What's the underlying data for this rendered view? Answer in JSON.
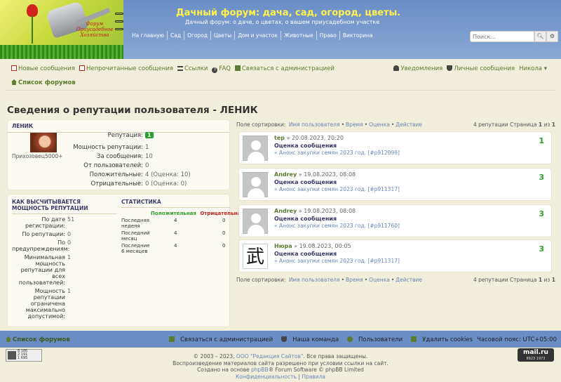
{
  "site": {
    "logo_text": "Форум Приусадебное Хозяйство",
    "title": "Дачный форум: дача, сад, огород, цветы.",
    "description": "Дачный форум: о даче, о цветах, о вашем приусадебном участке"
  },
  "topnav": [
    "На главную",
    "Сад",
    "Огород",
    "Цветы",
    "Дом и участок",
    "Животные",
    "Право",
    "Викторина"
  ],
  "search": {
    "placeholder": "Поиск...",
    "icon": "search-icon",
    "settings_icon": "gear-icon"
  },
  "navbar": {
    "new_posts": "Новые сообщения",
    "unread_posts": "Непрочитанные сообщения",
    "links": "Ссылки",
    "faq": "FAQ",
    "contact": "Связаться с администрацией",
    "notifications": "Уведомления",
    "pm": "Личные сообщения",
    "user": "Никола"
  },
  "breadcrumb": "Список форумов",
  "page_title": "Сведения о репутации пользователя - ЛЕНИК",
  "profile": {
    "username": "ЛЕНИК",
    "rank": "Прихозовец5000+",
    "rows": [
      {
        "label": "Репутация:",
        "value": "1",
        "badge": true
      },
      {
        "label": "Мощность репутации:",
        "value": "1"
      },
      {
        "label": "За сообщения:",
        "value": "10"
      },
      {
        "label": "От пользователей:",
        "value": "0"
      },
      {
        "label": "Положительные:",
        "value": "4 (Оценка: 10)"
      },
      {
        "label": "Отрицательные:",
        "value": "0 (Оценка: 0)"
      }
    ]
  },
  "how_calc": {
    "heading": "КАК ВЫСЧИТЫВАЕТСЯ МОЩНОСТЬ РЕПУТАЦИИ",
    "rows": [
      {
        "label": "По дате регистрации:",
        "value": "51"
      },
      {
        "label": "По репутации:",
        "value": "0"
      },
      {
        "label": "По предупреждениям:",
        "value": "0"
      },
      {
        "label": "Минимальная мощность репутации для всех пользователей:",
        "value": "1"
      },
      {
        "label": "Мощность репутации ограничена максимально допустимой:",
        "value": "1"
      }
    ]
  },
  "stats": {
    "heading": "СТАТИСТИКА",
    "col_pos": "Положительная",
    "col_neg": "Отрицательная",
    "rows": [
      {
        "label": "Последняя неделя",
        "pos": "4",
        "neg": "0"
      },
      {
        "label": "Последний месяц",
        "pos": "4",
        "neg": "0"
      },
      {
        "label": "Последние 6 месяцев",
        "pos": "4",
        "neg": "0"
      }
    ]
  },
  "sort": {
    "label": "Поле сортировки:",
    "options": [
      "Имя пользователя",
      "Время",
      "Оценка",
      "Действие"
    ],
    "pagination_prefix": "4 репутации Страница",
    "page": "1",
    "of": "из",
    "total": "1"
  },
  "entries": [
    {
      "user": "tep",
      "date": "» 20.08.2023, 20:20",
      "title": "Оценка сообщения",
      "topic": "» Анонс закупки семян 2023 год. [#p912099]",
      "score": "1",
      "avatar": "default"
    },
    {
      "user": "Andrey",
      "date": "» 19.08.2023, 08:08",
      "title": "Оценка сообщения",
      "topic": "» Анонс закупки семян 2023 год. [#p911317]",
      "score": "3",
      "avatar": "default"
    },
    {
      "user": "Andrey",
      "date": "» 19.08.2023, 08:08",
      "title": "Оценка сообщения",
      "topic": "» Анонс закупки семян 2023 год. [#p911760]",
      "score": "3",
      "avatar": "default"
    },
    {
      "user": "Нюра",
      "date": "» 19.08.2023, 00:05",
      "title": "Оценка сообщения",
      "topic": "» Анонс закупки семян 2023 год. [#p911317]",
      "score": "3",
      "avatar": "kanji",
      "avatar_glyph": "武"
    }
  ],
  "footer": {
    "breadcrumb": "Список форумов",
    "contact": "Связаться с администрацией",
    "team": "Наша команда",
    "members": "Пользователи",
    "delete_cookies": "Удалить cookies",
    "timezone": "Часовой пояс: UTC+05:00",
    "copyright_prefix": "© 2003 – 2023,",
    "copyright_link": "ООО \"Редакция Сайтов\"",
    "copyright_suffix": ". Все права защищены.",
    "reprint": "Воспроизведение материалов сайта разрешено при условии ссылки на сайт.",
    "based_prefix": "Создано на основе",
    "based_link": "phpBB",
    "based_suffix": "® Forum Software © phpBB Limited",
    "privacy": "Конфиденциальность",
    "sep": "|",
    "rules": "Правила",
    "counter": [
      "8 186",
      "2 191",
      "1 695"
    ],
    "mailru": "mail.ru",
    "mailru_nums": "8923   1973"
  }
}
